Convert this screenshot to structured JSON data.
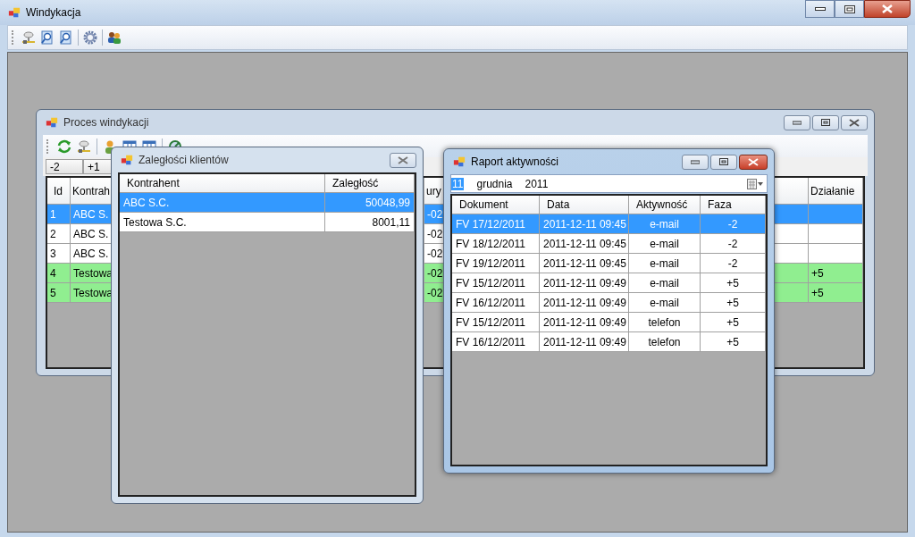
{
  "window": {
    "title": "Windykacja"
  },
  "proces": {
    "title": "Proces windykacji",
    "tabs": [
      {
        "label": "-2"
      },
      {
        "label": "+1"
      }
    ],
    "table": {
      "columns": [
        "Id",
        "Kontrah",
        "ury",
        "Działanie"
      ],
      "rows": [
        {
          "id": "1",
          "kontrahent": "ABC S.",
          "column_3": "-02",
          "selected": true
        },
        {
          "id": "2",
          "kontrahent": "ABC S.",
          "column_3": "-02",
          "selected": false,
          "color": "#ffffff"
        },
        {
          "id": "3",
          "kontrahent": "ABC S.",
          "column_3": "-02",
          "selected": false,
          "color": "#ffffff"
        },
        {
          "id": "4",
          "kontrahent": "Testowa",
          "column_3": "-02",
          "action": "+5",
          "selected": false,
          "color": "#90ee90"
        },
        {
          "id": "5",
          "kontrahent": "Testowa",
          "column_3": "-02",
          "action": "+5",
          "selected": false,
          "color": "#90ee90"
        }
      ]
    }
  },
  "zaleglosci": {
    "title": "Zaległości klientów",
    "columns": [
      "Kontrahent",
      "Zaległość"
    ],
    "rows": [
      {
        "kontrahent": "ABC S.C.",
        "amount": "50048,99",
        "selected": true
      },
      {
        "kontrahent": "Testowa S.C.",
        "amount": "8001,11",
        "selected": false
      }
    ]
  },
  "raport": {
    "title": "Raport aktywności",
    "date": {
      "day": "11",
      "month": "grudnia",
      "year": "2011"
    },
    "columns": [
      "Dokument",
      "Data",
      "Aktywność",
      "Faza"
    ],
    "rows": [
      {
        "document": "FV 17/12/2011",
        "date": "2011-12-11 09:45",
        "activity": "e-mail",
        "phase": "-2",
        "selected": true
      },
      {
        "document": "FV 18/12/2011",
        "date": "2011-12-11 09:45",
        "activity": "e-mail",
        "phase": "-2",
        "selected": false
      },
      {
        "document": "FV 19/12/2011",
        "date": "2011-12-11 09:45",
        "activity": "e-mail",
        "phase": "-2",
        "selected": false
      },
      {
        "document": "FV 15/12/2011",
        "date": "2011-12-11 09:49",
        "activity": "e-mail",
        "phase": "+5",
        "selected": false
      },
      {
        "document": "FV 16/12/2011",
        "date": "2011-12-11 09:49",
        "activity": "e-mail",
        "phase": "+5",
        "selected": false
      },
      {
        "document": "FV 15/12/2011",
        "date": "2011-12-11 09:49",
        "activity": "telefon",
        "phase": "+5",
        "selected": false
      },
      {
        "document": "FV 16/12/2011",
        "date": "2011-12-11 09:49",
        "activity": "telefon",
        "phase": "+5",
        "selected": false
      }
    ]
  }
}
